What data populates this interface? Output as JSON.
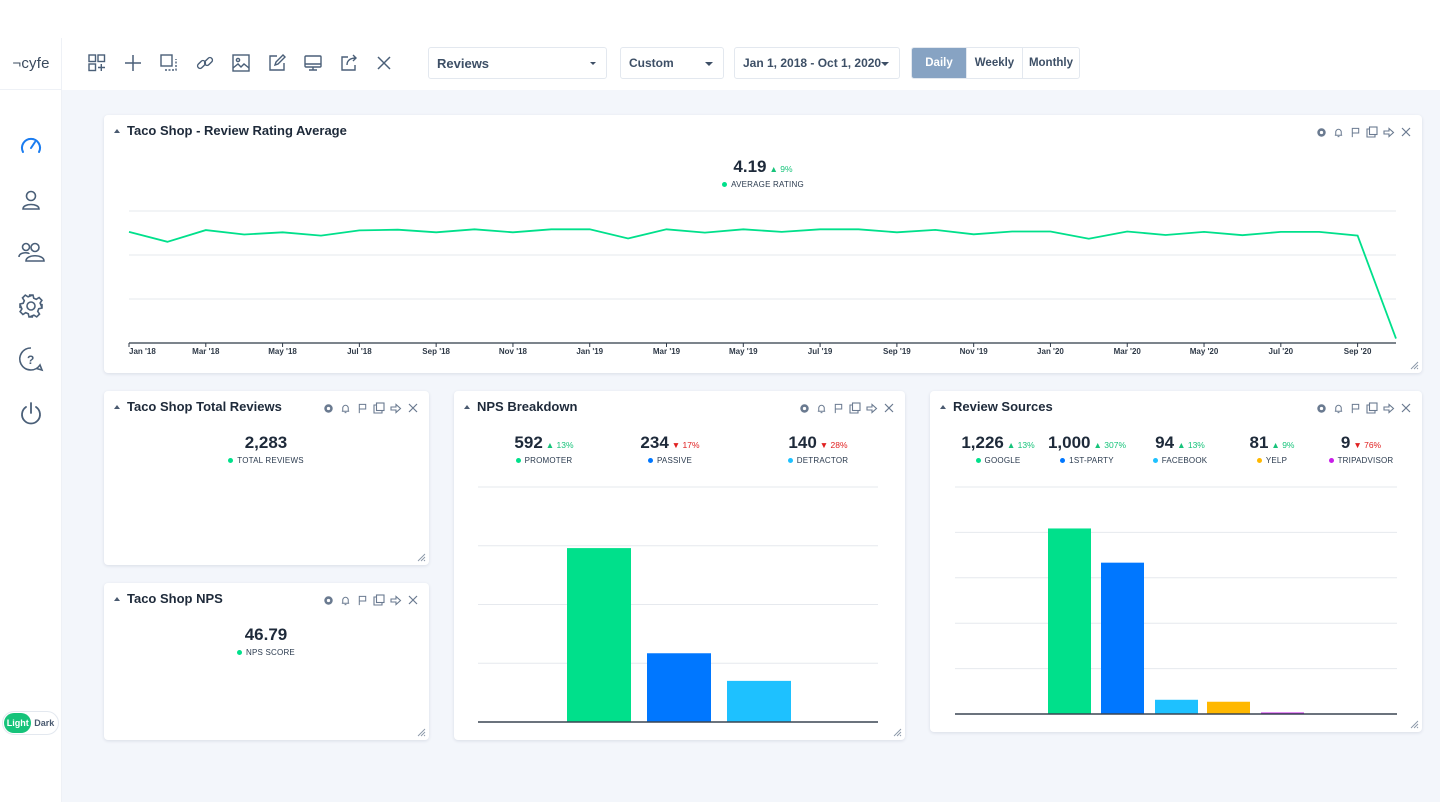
{
  "app": {
    "logo": "¬cyfe"
  },
  "sidebar": {
    "items": [
      {
        "name": "dashboard",
        "active": true
      },
      {
        "name": "account"
      },
      {
        "name": "users"
      },
      {
        "name": "settings"
      },
      {
        "name": "help"
      },
      {
        "name": "logout"
      }
    ],
    "theme": {
      "light_label": "Light",
      "dark_label": "Dark",
      "selected": "Light"
    }
  },
  "toolbar": {
    "icons": [
      "add-widget",
      "add",
      "duplicate-dashboard",
      "link",
      "image",
      "edit",
      "tv-mode",
      "export",
      "close"
    ],
    "dashboard_select": "Reviews",
    "range_select": "Custom",
    "date_range": "Jan 1, 2018 - Oct 1, 2020",
    "periods": [
      "Daily",
      "Weekly",
      "Monthly"
    ],
    "active_period": "Daily"
  },
  "colors": {
    "green": "#00e08b",
    "blue": "#0077ff",
    "cyan": "#1ec1ff",
    "yellow": "#ffb800",
    "purple": "#c81ee8",
    "accent": "#16c37a",
    "down": "#e02020"
  },
  "widgets": {
    "rating": {
      "title": "Taco Shop - Review Rating Average",
      "metric": {
        "value": "4.19",
        "change": "▲ 9%",
        "direction": "up",
        "label": "AVERAGE RATING"
      }
    },
    "total_reviews": {
      "title": "Taco Shop Total Reviews",
      "metric": {
        "value": "2,283",
        "label": "TOTAL REVIEWS"
      }
    },
    "nps": {
      "title": "Taco Shop NPS",
      "metric": {
        "value": "46.79",
        "label": "NPS SCORE"
      }
    },
    "nps_breakdown": {
      "title": "NPS Breakdown",
      "metrics": [
        {
          "value": "592",
          "change": "▲ 13%",
          "direction": "up",
          "label": "PROMOTER",
          "color": "#00e08b"
        },
        {
          "value": "234",
          "change": "▼ 17%",
          "direction": "down",
          "label": "PASSIVE",
          "color": "#0077ff"
        },
        {
          "value": "140",
          "change": "▼ 28%",
          "direction": "down",
          "label": "DETRACTOR",
          "color": "#1ec1ff"
        }
      ]
    },
    "review_sources": {
      "title": "Review Sources",
      "metrics": [
        {
          "value": "1,226",
          "change": "▲ 13%",
          "direction": "up",
          "label": "GOOGLE",
          "color": "#00e08b"
        },
        {
          "value": "1,000",
          "change": "▲ 307%",
          "direction": "up",
          "label": "1ST-PARTY",
          "color": "#0077ff"
        },
        {
          "value": "94",
          "change": "▲ 13%",
          "direction": "up",
          "label": "FACEBOOK",
          "color": "#1ec1ff"
        },
        {
          "value": "81",
          "change": "▲ 9%",
          "direction": "up",
          "label": "YELP",
          "color": "#ffb800"
        },
        {
          "value": "9",
          "change": "▼ 76%",
          "direction": "down",
          "label": "TRIPADVISOR",
          "color": "#c81ee8"
        }
      ]
    }
  },
  "chart_data": [
    {
      "id": "rating",
      "type": "line",
      "title": "Taco Shop - Review Rating Average",
      "xlabel": "",
      "ylabel": "",
      "ylim": [
        0,
        6
      ],
      "grid": true,
      "x_tick_labels": [
        "Jan '18",
        "Mar '18",
        "May '18",
        "Jul '18",
        "Sep '18",
        "Nov '18",
        "Jan '19",
        "Mar '19",
        "May '19",
        "Jul '19",
        "Sep '19",
        "Nov '19",
        "Jan '20",
        "Mar '20",
        "May '20",
        "Jul '20",
        "Sep '20"
      ],
      "x": [
        "2018-01",
        "2018-02",
        "2018-03",
        "2018-04",
        "2018-05",
        "2018-06",
        "2018-07",
        "2018-08",
        "2018-09",
        "2018-10",
        "2018-11",
        "2018-12",
        "2019-01",
        "2019-02",
        "2019-03",
        "2019-04",
        "2019-05",
        "2019-06",
        "2019-07",
        "2019-08",
        "2019-09",
        "2019-10",
        "2019-11",
        "2019-12",
        "2020-01",
        "2020-02",
        "2020-03",
        "2020-04",
        "2020-05",
        "2020-06",
        "2020-07",
        "2020-08",
        "2020-09",
        "2020-10"
      ],
      "series": [
        {
          "name": "Average Rating",
          "color": "#00e08b",
          "values": [
            5.05,
            4.6,
            5.13,
            4.93,
            5.03,
            4.88,
            5.12,
            5.15,
            5.03,
            5.17,
            5.03,
            5.17,
            5.17,
            4.75,
            5.17,
            5.02,
            5.17,
            5.05,
            5.17,
            5.17,
            5.03,
            5.14,
            4.94,
            5.07,
            5.07,
            4.74,
            5.07,
            4.91,
            5.05,
            4.9,
            5.05,
            5.05,
            4.88,
            0.2
          ]
        }
      ]
    },
    {
      "id": "nps_breakdown",
      "type": "bar",
      "title": "NPS Breakdown",
      "categories": [
        "Promoter",
        "Passive",
        "Detractor"
      ],
      "values": [
        592,
        234,
        140
      ],
      "colors": [
        "#00e08b",
        "#0077ff",
        "#1ec1ff"
      ],
      "ylim": [
        0,
        800
      ],
      "grid": true
    },
    {
      "id": "review_sources",
      "type": "bar",
      "title": "Review Sources",
      "categories": [
        "Google",
        "1st-Party",
        "Facebook",
        "Yelp",
        "TripAdvisor"
      ],
      "values": [
        1226,
        1000,
        94,
        81,
        9
      ],
      "colors": [
        "#00e08b",
        "#0077ff",
        "#1ec1ff",
        "#ffb800",
        "#c81ee8"
      ],
      "ylim": [
        0,
        1500
      ],
      "grid": true
    }
  ]
}
